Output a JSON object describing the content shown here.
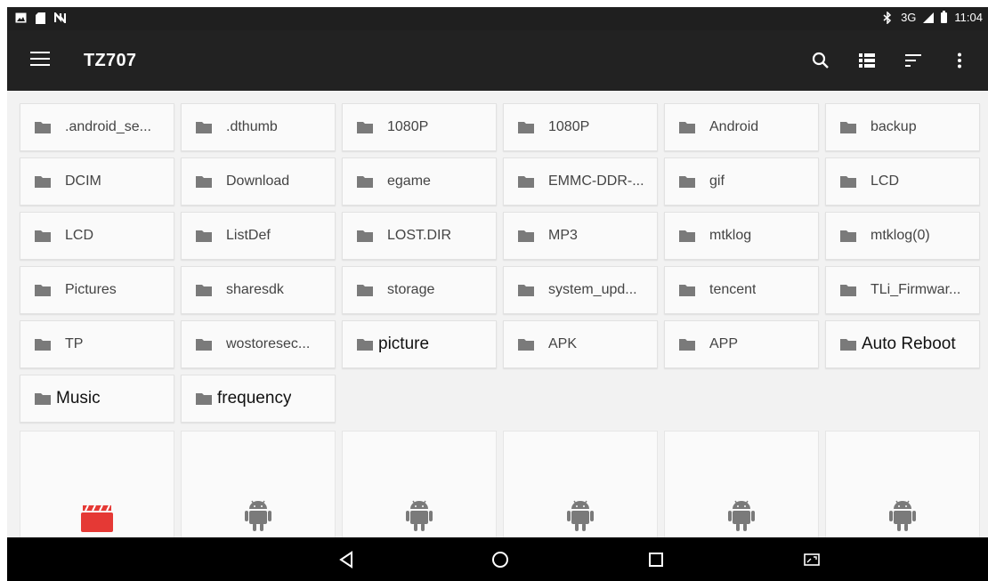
{
  "status_bar": {
    "left_icons": [
      "image-icon",
      "sd-card-icon",
      "nfc-icon"
    ],
    "network": "3G",
    "time": "11:04"
  },
  "toolbar": {
    "title": "TZ707",
    "actions": [
      "search-icon",
      "list-view-icon",
      "sort-icon",
      "more-icon"
    ]
  },
  "folders": [
    ".android_se...",
    ".dthumb",
    "1080P",
    "1080P",
    "Android",
    "backup",
    "DCIM",
    "Download",
    "egame",
    "EMMC-DDR-...",
    "gif",
    "LCD",
    "LCD",
    "ListDef",
    "LOST.DIR",
    "MP3",
    "mtklog",
    "mtklog(0)",
    "Pictures",
    "sharesdk",
    "storage",
    "system_upd...",
    "tencent",
    "TLi_Firmwar...",
    "TP",
    "wostoresec...",
    "picture",
    "APK",
    "APP",
    "Auto Reboot",
    "Music",
    "frequency"
  ],
  "files": [
    {
      "icon": "video-clapper-icon"
    },
    {
      "icon": "android-icon"
    },
    {
      "icon": "android-icon"
    },
    {
      "icon": "android-icon"
    },
    {
      "icon": "android-icon"
    },
    {
      "icon": "android-icon"
    }
  ],
  "colors": {
    "toolbar": "#222222",
    "folder_icon": "#7a7a7a",
    "video_icon": "#e53935",
    "android_icon": "#7a7a7a"
  }
}
